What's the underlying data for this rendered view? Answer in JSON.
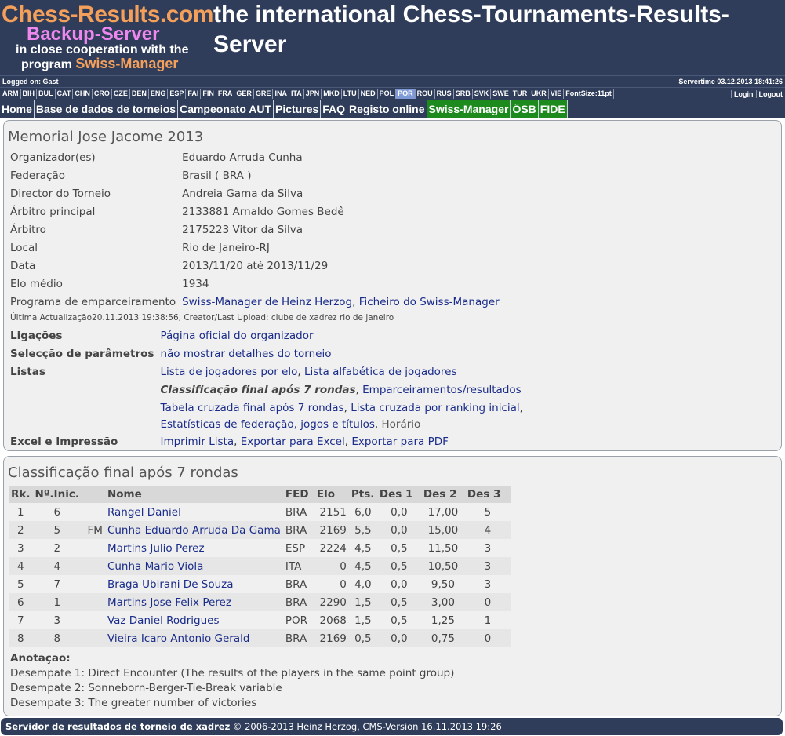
{
  "header": {
    "site": "Chess-Results.com",
    "tagline": "the international Chess-Tournaments-Results-Server",
    "backup": "Backup-Server",
    "coop": "in close cooperation with the",
    "program_prefix": "program ",
    "program_name": "Swiss-Manager"
  },
  "infobar": {
    "logged_on": "Logged on: Gast",
    "servertime": "Servertime 03.12.2013 18:41:26"
  },
  "languages": [
    "ARM",
    "BIH",
    "BUL",
    "CAT",
    "CHN",
    "CRO",
    "CZE",
    "DEN",
    "ENG",
    "ESP",
    "FAI",
    "FIN",
    "FRA",
    "GER",
    "GRE",
    "INA",
    "ITA",
    "JPN",
    "MKD",
    "LTU",
    "NED",
    "POL",
    "POR",
    "ROU",
    "RUS",
    "SRB",
    "SVK",
    "SWE",
    "TUR",
    "UKR",
    "VIE",
    "FontSize:11pt"
  ],
  "active_language": "POR",
  "login": "Login",
  "logout": "Logout",
  "nav": [
    {
      "label": "Home",
      "green": false
    },
    {
      "label": "Base de dados de torneios",
      "green": false
    },
    {
      "label": "Campeonato AUT",
      "green": false
    },
    {
      "label": "Pictures",
      "green": false
    },
    {
      "label": "FAQ",
      "green": false
    },
    {
      "label": "Registo online",
      "green": false
    },
    {
      "label": "Swiss-Manager",
      "green": true
    },
    {
      "label": "ÖSB",
      "green": true
    },
    {
      "label": "FIDE",
      "green": true
    }
  ],
  "tournament": {
    "title": "Memorial Jose Jacome 2013",
    "fields": [
      {
        "label": "Organizador(es)",
        "value": "Eduardo Arruda Cunha"
      },
      {
        "label": "Federação",
        "value": "Brasil ( BRA )"
      },
      {
        "label": "Director do Torneio",
        "value": "Andreia Gama da Silva"
      },
      {
        "label": "Árbitro principal",
        "value": "2133881 Arnaldo Gomes Bedê"
      },
      {
        "label": "Árbitro",
        "value": "2175223 Vitor da Silva"
      },
      {
        "label": "Local",
        "value": "Rio de Janeiro-RJ"
      },
      {
        "label": "Data",
        "value": "2013/11/20 até 2013/11/29"
      },
      {
        "label": "Elo médio",
        "value": "1934"
      }
    ],
    "pairing_label": "Programa de emparceiramento",
    "pairing_link1": "Swiss-Manager de Heinz Herzog",
    "pairing_link2": "Ficheiro do Swiss-Manager",
    "last_update": "Última Actualização20.11.2013 19:38:56, Creator/Last Upload: clube de xadrez rio de janeiro",
    "links_label": "Ligações",
    "links_value": "Página oficial do organizador",
    "params_label": "Selecção de parâmetros",
    "params_value": "não mostrar detalhes do torneio",
    "lists_label": "Listas",
    "list_elo": "Lista de jogadores por elo",
    "list_alpha": "Lista alfabética de jogadores",
    "list_final": "Classificação final após 7 rondas",
    "list_pairings": "Emparceiramentos/resultados",
    "list_cross": "Tabela cruzada final após 7 rondas",
    "list_cross_rank": "Lista cruzada por ranking inicial",
    "list_fed": "Estatísticas de federação, jogos e títulos",
    "list_schedule": "Horário",
    "export_label": "Excel e Impressão",
    "export_print": "Imprimir Lista",
    "export_excel": "Exportar para Excel",
    "export_pdf": "Exportar para PDF"
  },
  "standings": {
    "title": "Classificação final após 7 rondas",
    "headers": [
      "Rk.",
      "Nº.Inic.",
      "",
      "Nome",
      "FED",
      "Elo",
      "Pts.",
      "Des 1",
      "Des 2",
      "Des 3"
    ],
    "rows": [
      {
        "rk": "1",
        "sno": "6",
        "title": "",
        "name": "Rangel Daniel",
        "fed": "BRA",
        "elo": "2151",
        "pts": "6,0",
        "d1": "0,0",
        "d2": "17,00",
        "d3": "5"
      },
      {
        "rk": "2",
        "sno": "5",
        "title": "FM",
        "name": "Cunha Eduardo Arruda Da Gama",
        "fed": "BRA",
        "elo": "2169",
        "pts": "5,5",
        "d1": "0,0",
        "d2": "15,00",
        "d3": "4"
      },
      {
        "rk": "3",
        "sno": "2",
        "title": "",
        "name": "Martins Julio Perez",
        "fed": "ESP",
        "elo": "2224",
        "pts": "4,5",
        "d1": "0,5",
        "d2": "11,50",
        "d3": "3"
      },
      {
        "rk": "4",
        "sno": "4",
        "title": "",
        "name": "Cunha Mario Viola",
        "fed": "ITA",
        "elo": "0",
        "pts": "4,5",
        "d1": "0,5",
        "d2": "10,50",
        "d3": "3"
      },
      {
        "rk": "5",
        "sno": "7",
        "title": "",
        "name": "Braga Ubirani De Souza",
        "fed": "BRA",
        "elo": "0",
        "pts": "4,0",
        "d1": "0,0",
        "d2": "9,50",
        "d3": "3"
      },
      {
        "rk": "6",
        "sno": "1",
        "title": "",
        "name": "Martins Jose Felix Perez",
        "fed": "BRA",
        "elo": "2290",
        "pts": "1,5",
        "d1": "0,5",
        "d2": "3,00",
        "d3": "0"
      },
      {
        "rk": "7",
        "sno": "3",
        "title": "",
        "name": "Vaz Daniel Rodrigues",
        "fed": "POR",
        "elo": "2068",
        "pts": "1,5",
        "d1": "0,5",
        "d2": "1,25",
        "d3": "1"
      },
      {
        "rk": "8",
        "sno": "8",
        "title": "",
        "name": "Vieira Icaro Antonio Gerald",
        "fed": "BRA",
        "elo": "2169",
        "pts": "0,5",
        "d1": "0,0",
        "d2": "0,75",
        "d3": "0"
      }
    ],
    "note_title": "Anotação:",
    "notes": [
      "Desempate 1: Direct Encounter (The results of the players in the same point group)",
      "Desempate 2: Sonneborn-Berger-Tie-Break variable",
      "Desempate 3: The greater number of victories"
    ]
  },
  "footer": {
    "bold": "Servidor de resultados de torneio de xadrez",
    "rest": " © 2006-2013 Heinz Herzog, CMS-Version 16.11.2013 19:26"
  },
  "colors": {
    "header_bg": "#2f3d5a",
    "logo_orange": "#f5a05a",
    "logo_pink": "#ee88ee",
    "nav_green": "#1d8a1d",
    "link": "#1a2c8a"
  }
}
